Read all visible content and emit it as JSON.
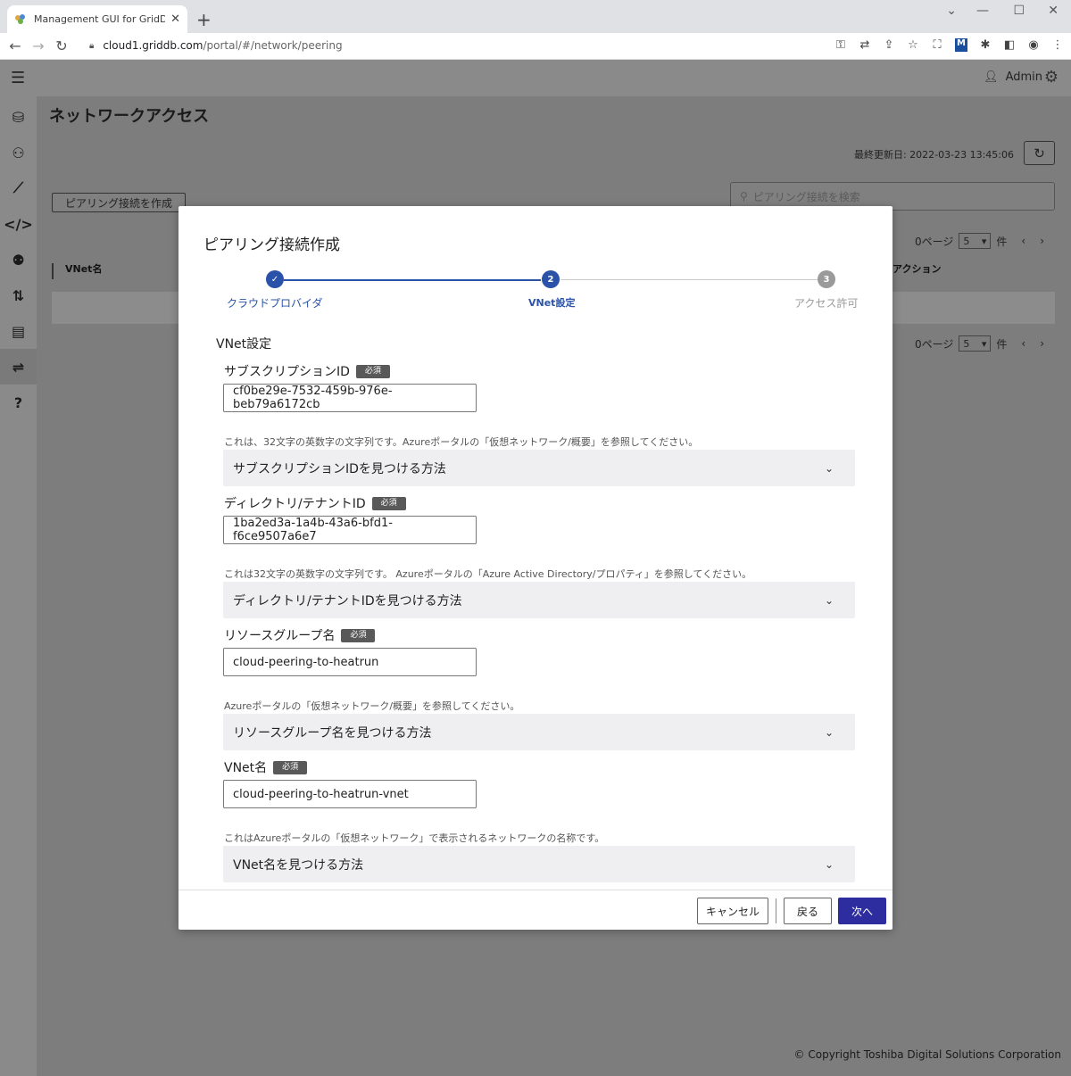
{
  "browser": {
    "tab_title": "Management GUI for GridDB Clo",
    "tab_close": "✕",
    "new_tab": "+",
    "url_host": "cloud1.griddb.com",
    "url_path": "/portal/#/network/peering"
  },
  "app": {
    "admin_label": "Admin",
    "page_title": "ネットワークアクセス",
    "last_updated": "最終更新日: 2022-03-23 13:45:06",
    "create_button": "ピアリング接続を作成",
    "search_placeholder": "ピアリング接続を検索",
    "pager_label": "0ページ",
    "pager_size": "5",
    "pager_unit": "件",
    "col_vnet": "VNet名",
    "col_action": "アクション",
    "copyright": "© Copyright Toshiba Digital Solutions Corporation"
  },
  "modal": {
    "title": "ピアリング接続作成",
    "steps": [
      {
        "label": "クラウドプロバイダ",
        "number": "1",
        "state": "done"
      },
      {
        "label": "VNet設定",
        "number": "2",
        "state": "active"
      },
      {
        "label": "アクセス許可",
        "number": "3",
        "state": "pending"
      }
    ],
    "section_heading": "VNet設定",
    "required_badge": "必須",
    "fields": [
      {
        "label": "サブスクリプションID",
        "value": "cf0be29e-7532-459b-976e-beb79a6172cb",
        "hint": "これは、32文字の英数字の文字列です。Azureポータルの「仮想ネットワーク/概要」を参照してください。",
        "expander": "サブスクリプションIDを見つける方法"
      },
      {
        "label": "ディレクトリ/テナントID",
        "value": "1ba2ed3a-1a4b-43a6-bfd1-f6ce9507a6e7",
        "hint": "これは32文字の英数字の文字列です。 Azureポータルの「Azure Active Directory/プロパティ」を参照してください。",
        "expander": "ディレクトリ/テナントIDを見つける方法"
      },
      {
        "label": "リソースグループ名",
        "value": "cloud-peering-to-heatrun",
        "hint": "Azureポータルの「仮想ネットワーク/概要」を参照してください。",
        "expander": "リソースグループ名を見つける方法"
      },
      {
        "label": "VNet名",
        "value": "cloud-peering-to-heatrun-vnet",
        "hint": "これはAzureポータルの「仮想ネットワーク」で表示されるネットワークの名称です。",
        "expander": "VNet名を見つける方法"
      }
    ],
    "cancel_button": "キャンセル",
    "back_button": "戻る",
    "next_button": "次へ"
  },
  "colors": {
    "primary": "#2d2d9f",
    "step_done": "#2a52a8",
    "step_pending": "#9a9a9a",
    "overlay": "#7d7d7d"
  }
}
